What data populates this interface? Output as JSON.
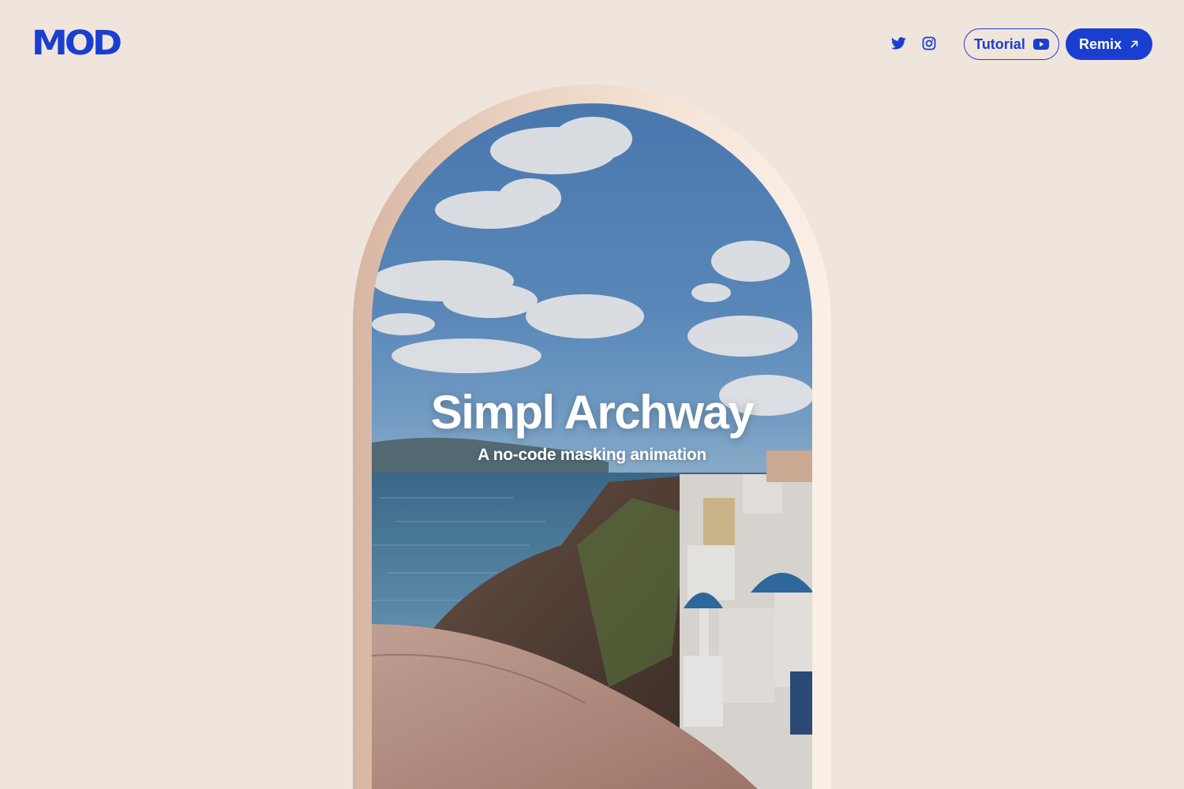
{
  "header": {
    "logo_text": "MOD",
    "social": [
      {
        "icon": "twitter-icon"
      },
      {
        "icon": "instagram-icon"
      }
    ],
    "tutorial_label": "Tutorial",
    "tutorial_icon": "youtube-play-icon",
    "remix_label": "Remix",
    "remix_icon": "arrow-up-right-icon"
  },
  "hero": {
    "title": "Simpl Archway",
    "subtitle": "A no-code masking animation"
  },
  "colors": {
    "background": "#f0e5dc",
    "accent": "#1a3fd0",
    "arch_frame": "#e8cdbb"
  }
}
